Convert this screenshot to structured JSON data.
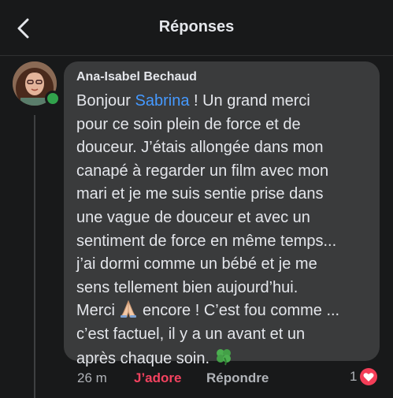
{
  "header": {
    "title": "Réponses",
    "back_icon": "chevron-left-icon"
  },
  "comment": {
    "author": "Ana-Isabel Bechaud",
    "online": true,
    "lines": [
      {
        "pre": "Bonjour ",
        "mention": "Sabrina",
        "post": " ! Un grand merci"
      },
      {
        "text": "pour ce soin plein de force et de"
      },
      {
        "text": "douceur. J’étais allongée dans mon"
      },
      {
        "text": "canapé à regarder un film avec mon"
      },
      {
        "text": "mari et je me suis sentie prise dans"
      },
      {
        "text": "une vague de douceur et avec un"
      },
      {
        "text": "sentiment de force en même temps..."
      },
      {
        "text": "j’ai dormi comme un bébé et je me"
      },
      {
        "text": "sens tellement bien aujourd’hui."
      },
      {
        "pre": "Merci ",
        "emoji": "folded-hands",
        "post": " encore ! C’est fou comme ..."
      },
      {
        "text": "c’est factuel, il y a un avant et un"
      },
      {
        "pre": "après chaque soin. ",
        "emoji": "four-leaf-clover"
      }
    ]
  },
  "actions": {
    "time": "26 m",
    "reaction_label": "J’adore",
    "reply_label": "Répondre",
    "reaction_count": "1",
    "reaction_icon": "heart-icon"
  },
  "colors": {
    "background": "#18191a",
    "bubble": "#3a3b3c",
    "mention": "#4599ff",
    "jadore": "#f3425f",
    "online": "#31a24c"
  }
}
